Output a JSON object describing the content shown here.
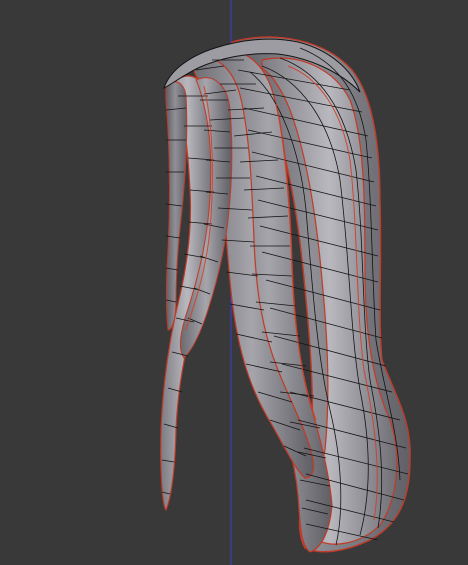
{
  "viewport": {
    "mode": "3d-viewport",
    "mesh_object": "hair-strands",
    "display": "wireframe-over-solid",
    "colors": {
      "background": "#393939",
      "mesh_fill": "#8a8a8f",
      "mesh_dark": "#5a5a60",
      "mesh_light": "#b4b4ba",
      "wire": "#141414",
      "selected_edge": "#d0402a",
      "z_axis": "#3b3bd1"
    }
  }
}
